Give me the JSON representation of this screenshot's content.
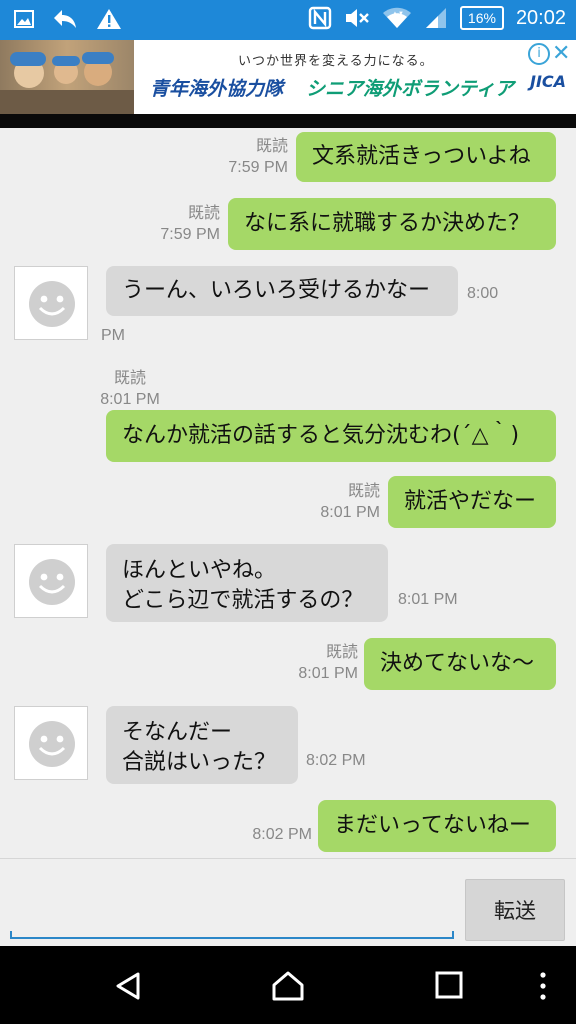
{
  "status_bar": {
    "battery": "16%",
    "time": "20:02",
    "icons": [
      "image-icon",
      "reply-icon",
      "warning-icon",
      "nfc-icon",
      "mute-icon",
      "wifi-icon",
      "signal-icon",
      "battery-icon"
    ]
  },
  "ad": {
    "tagline": "いつか世界を変える力になる。",
    "headline_left": "青年海外協力隊",
    "headline_right": "シニア海外ボランティア",
    "brand": "JICA",
    "info": "i",
    "close": "✕",
    "colors": {
      "left": "#1a4fa0",
      "right": "#0f9d76"
    }
  },
  "messages": [
    {
      "side": "sent",
      "text": "文系就活きっついよね",
      "read": "既読",
      "time": "7:59 PM"
    },
    {
      "side": "sent",
      "text": "なに系に就職するか決めた？",
      "read": "既読",
      "time": "7:59 PM"
    },
    {
      "side": "recv",
      "text": "うーん、いろいろ受けるかなー",
      "time1": "8:00",
      "time2": "PM"
    },
    {
      "side": "sent",
      "text": "なんか就活の話すると気分沈むわ(´△｀)",
      "read": "既読",
      "time": "8:01 PM"
    },
    {
      "side": "sent",
      "text": "就活やだなー",
      "read": "既読",
      "time": "8:01 PM"
    },
    {
      "side": "recv",
      "lines": [
        "ほんといやね。",
        "どこら辺で就活するの？"
      ],
      "time": "8:01 PM"
    },
    {
      "side": "sent",
      "text": "決めてないな〜",
      "read": "既読",
      "time": "8:01 PM"
    },
    {
      "side": "recv",
      "lines": [
        "そなんだー",
        "合説はいった？"
      ],
      "time": "8:02 PM"
    },
    {
      "side": "sent",
      "text": "まだいってないねー",
      "time": "8:02 PM"
    }
  ],
  "input": {
    "placeholder": "",
    "value": ""
  },
  "send_label": "転送",
  "colors": {
    "sent_bubble": "#a5d867",
    "recv_bubble": "#d8d8d8",
    "status_bar": "#1e88d8"
  }
}
